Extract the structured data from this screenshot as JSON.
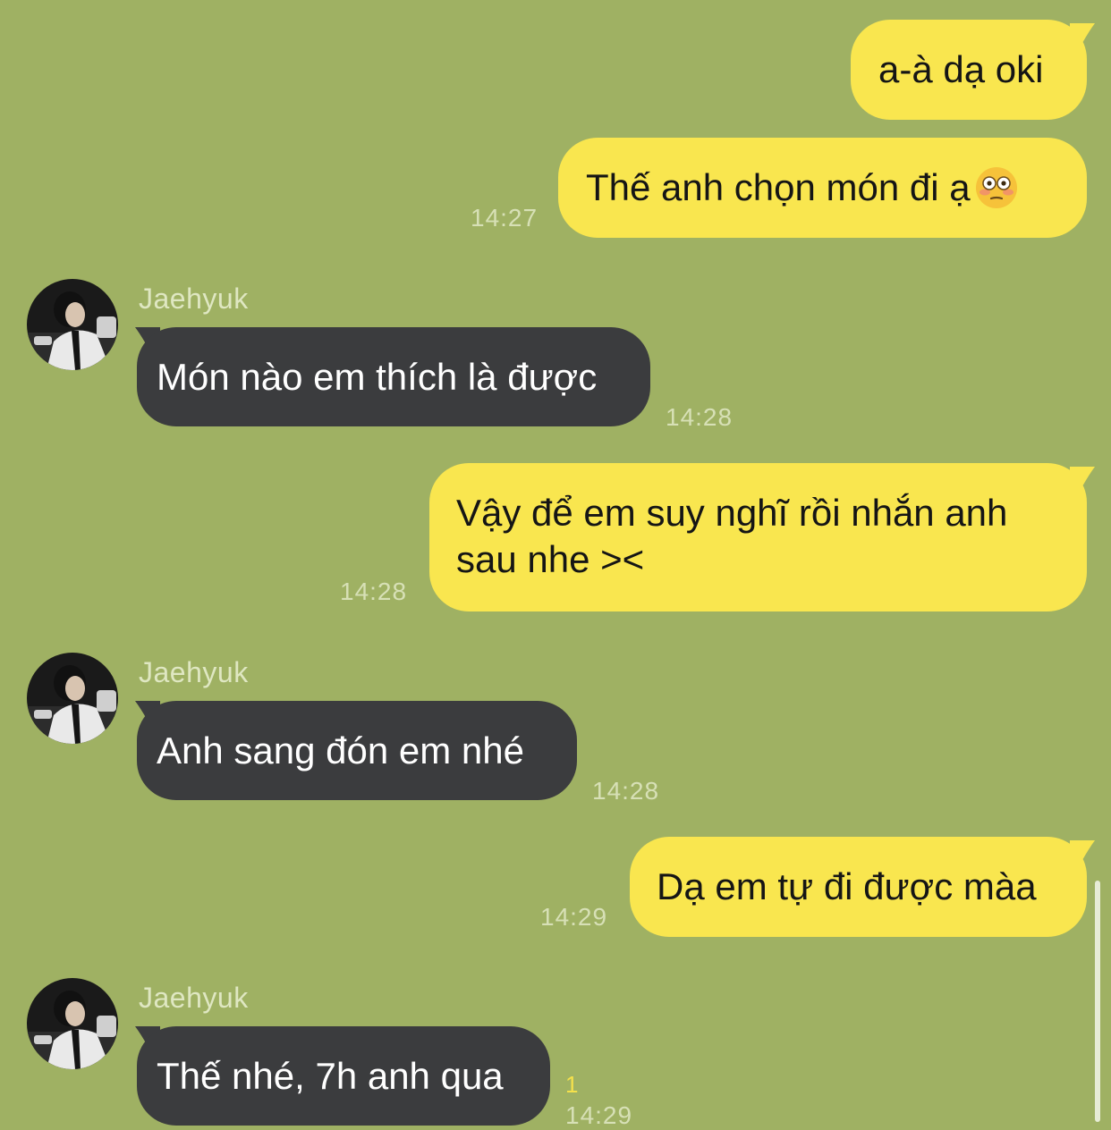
{
  "chat": {
    "background_color": "#9fb163",
    "outgoing_color": "#f9e64f",
    "incoming_color": "#3b3c3e",
    "messages": [
      {
        "direction": "out",
        "text": "a-à dạ oki",
        "time": ""
      },
      {
        "direction": "out",
        "text": "Thế anh chọn món đi ạ",
        "emoji": "flushed-face-emoji",
        "time": "14:27"
      },
      {
        "direction": "in",
        "sender": "Jaehyuk",
        "avatar": "avatar-photo",
        "text": "Món nào em thích là được",
        "time": "14:28"
      },
      {
        "direction": "out",
        "text_line1": "Vậy để em suy nghĩ rồi nhắn anh",
        "text_line2": "sau nhe ><",
        "time": "14:28"
      },
      {
        "direction": "in",
        "sender": "Jaehyuk",
        "avatar": "avatar-photo",
        "text": "Anh sang đón em nhé",
        "time": "14:28"
      },
      {
        "direction": "out",
        "text": "Dạ em tự đi được màa",
        "time": "14:29"
      },
      {
        "direction": "in",
        "sender": "Jaehyuk",
        "avatar": "avatar-photo",
        "text": "Thế nhé, 7h anh qua",
        "unread": "1",
        "time": "14:29"
      }
    ]
  }
}
